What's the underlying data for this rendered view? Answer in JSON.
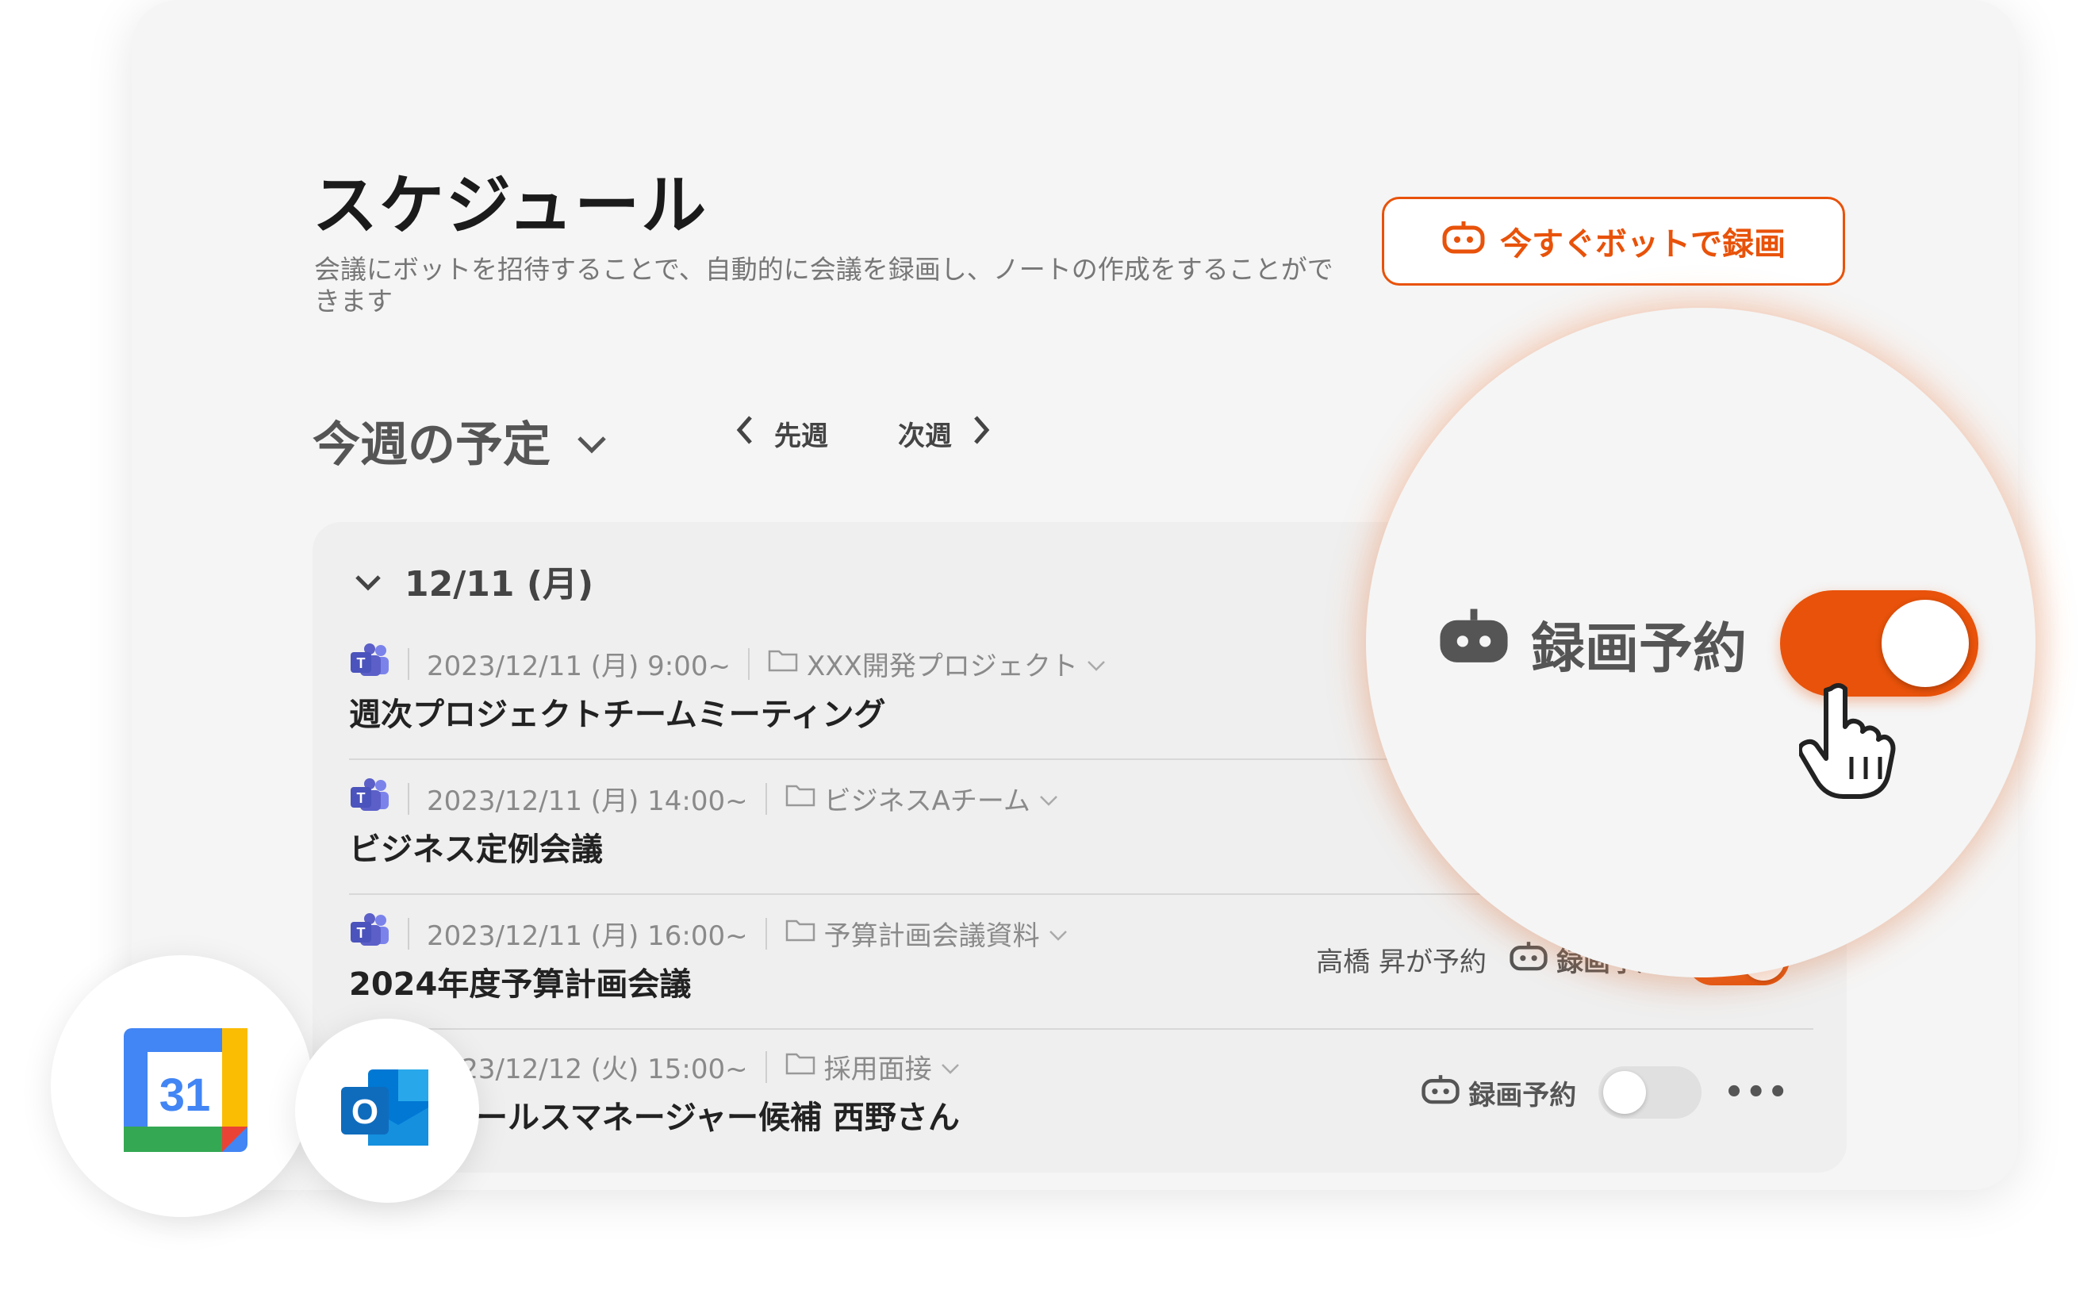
{
  "header": {
    "title": "スケジュール",
    "description": "会議にボットを招待することで、自動的に会議を録画し、ノートの作成をすることができます",
    "record_now_label": "今すぐボットで録画"
  },
  "week": {
    "title": "今週の予定",
    "prev_label": "先週",
    "next_label": "次週"
  },
  "date_group": {
    "label": "12/11 (月)"
  },
  "meetings": [
    {
      "datetime": "2023/12/11 (月) 9:00~",
      "folder": "XXX開発プロジェクト",
      "title": "週次プロジェクトチームミーティング",
      "platform_icon": "teams-icon"
    },
    {
      "datetime": "2023/12/11 (月) 14:00~",
      "folder": "ビジネスAチーム",
      "title": "ビジネス定例会議",
      "platform_icon": "teams-icon"
    },
    {
      "datetime": "2023/12/11 (月) 16:00~",
      "folder": "予算計画会議資料",
      "title": "2024年度予算計画会議",
      "platform_icon": "teams-icon",
      "reserved_by": "高橋 昇が予約",
      "record_label": "録画予約",
      "record_on": true
    },
    {
      "datetime": "2023/12/12 (火) 15:00~",
      "folder": "採用面接",
      "title": "面接：セールスマネージャー候補 西野さん",
      "record_label": "録画予約",
      "record_on": false,
      "more_label": "•••"
    }
  ],
  "zoom": {
    "label": "録画予約",
    "toggle_on": true
  },
  "apps": {
    "google_calendar_number": "31",
    "outlook_letter": "O"
  },
  "colors": {
    "accent": "#e8520a",
    "teams": "#5b5fc7",
    "text_muted": "#8a8a8a"
  }
}
